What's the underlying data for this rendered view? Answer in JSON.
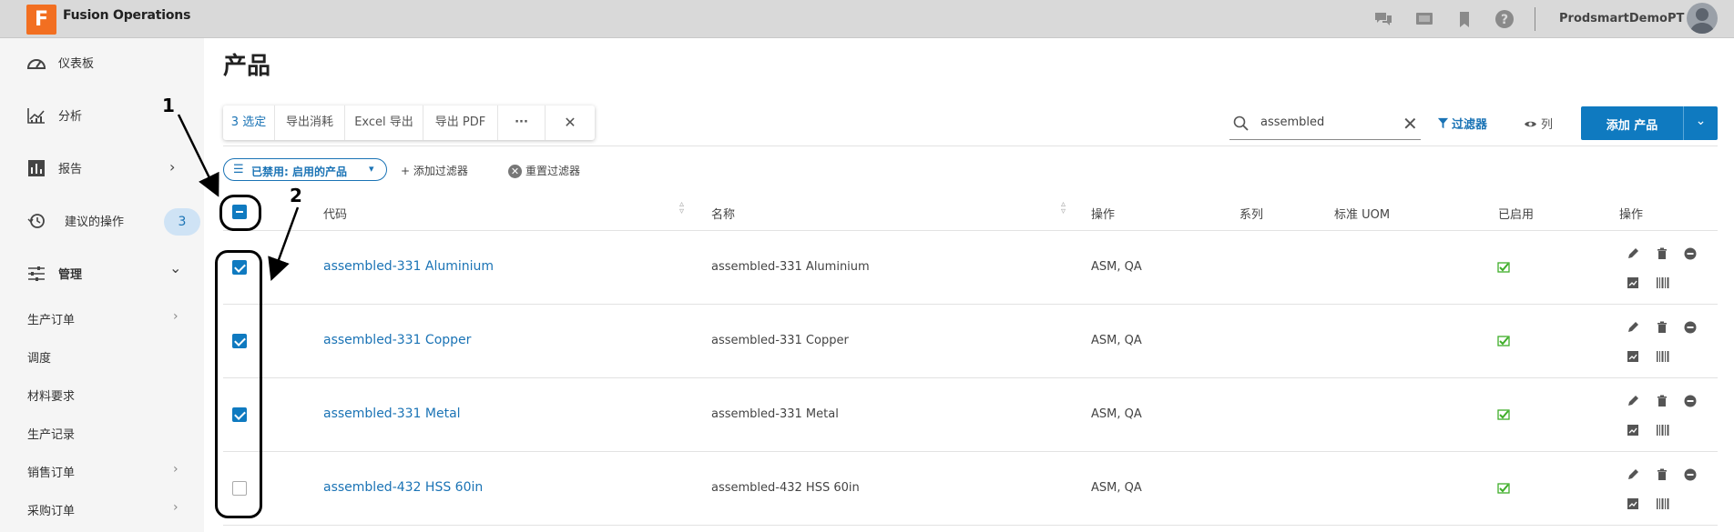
{
  "app": {
    "logo_letter": "F",
    "title": "Fusion Operations",
    "username": "ProdsmartDemoPT",
    "top_icons": [
      "chat-icon",
      "monitor-icon",
      "bookmark-icon",
      "help-icon"
    ]
  },
  "sidebar": {
    "items": [
      {
        "label": "仪表板",
        "icon": "dashboard-icon"
      },
      {
        "label": "分析",
        "icon": "analytics-icon"
      },
      {
        "label": "报告",
        "icon": "report-icon",
        "chevron": "›"
      },
      {
        "label": "建议的操作",
        "icon": "history-icon",
        "badge": "3"
      },
      {
        "label": "管理",
        "icon": "sliders-icon",
        "chevron": "⌄"
      }
    ],
    "subitems": [
      {
        "label": "生产订单",
        "chevron": "›"
      },
      {
        "label": "调度",
        "chevron": ""
      },
      {
        "label": "材料要求",
        "chevron": ""
      },
      {
        "label": "生产记录",
        "chevron": ""
      },
      {
        "label": "销售订单",
        "chevron": "›"
      },
      {
        "label": "采购订单",
        "chevron": "›"
      }
    ]
  },
  "page": {
    "title": "产品"
  },
  "bulk": {
    "selected": "3 选定",
    "export_consume": "导出消耗",
    "excel_export": "Excel 导出",
    "pdf_export": "导出 PDF",
    "more": "···",
    "close": "✕"
  },
  "search": {
    "value": "assembled",
    "clear": "✕"
  },
  "toolbar": {
    "filter": "过滤器",
    "columns": "列",
    "add_product": "添加 产品",
    "dropdown": "⌄"
  },
  "filters": {
    "active_chip": "已禁用: 启用的产品",
    "add_filter": "+ 添加过滤器",
    "reset_filter": "重置过滤器"
  },
  "table": {
    "headers": {
      "code": "代码",
      "name": "名称",
      "operation": "操作",
      "series": "系列",
      "uom": "标准 UOM",
      "enabled": "已启用",
      "actions": "操作"
    },
    "rows": [
      {
        "code": "assembled-331 Aluminium",
        "name": "assembled-331 Aluminium",
        "operation": "ASM, QA",
        "checked": true,
        "enabled": true
      },
      {
        "code": "assembled-331 Copper",
        "name": "assembled-331 Copper",
        "operation": "ASM, QA",
        "checked": true,
        "enabled": true
      },
      {
        "code": "assembled-331 Metal",
        "name": "assembled-331 Metal",
        "operation": "ASM, QA",
        "checked": true,
        "enabled": true
      },
      {
        "code": "assembled-432 HSS 60in",
        "name": "assembled-432 HSS 60in",
        "operation": "ASM, QA",
        "checked": false,
        "enabled": true
      }
    ]
  },
  "annotations": {
    "label_1": "1",
    "label_2": "2"
  },
  "colors": {
    "accent": "#0f7ac0",
    "link": "#1a73b5",
    "logo": "#f26f21",
    "enabled_check": "#3fae29"
  }
}
